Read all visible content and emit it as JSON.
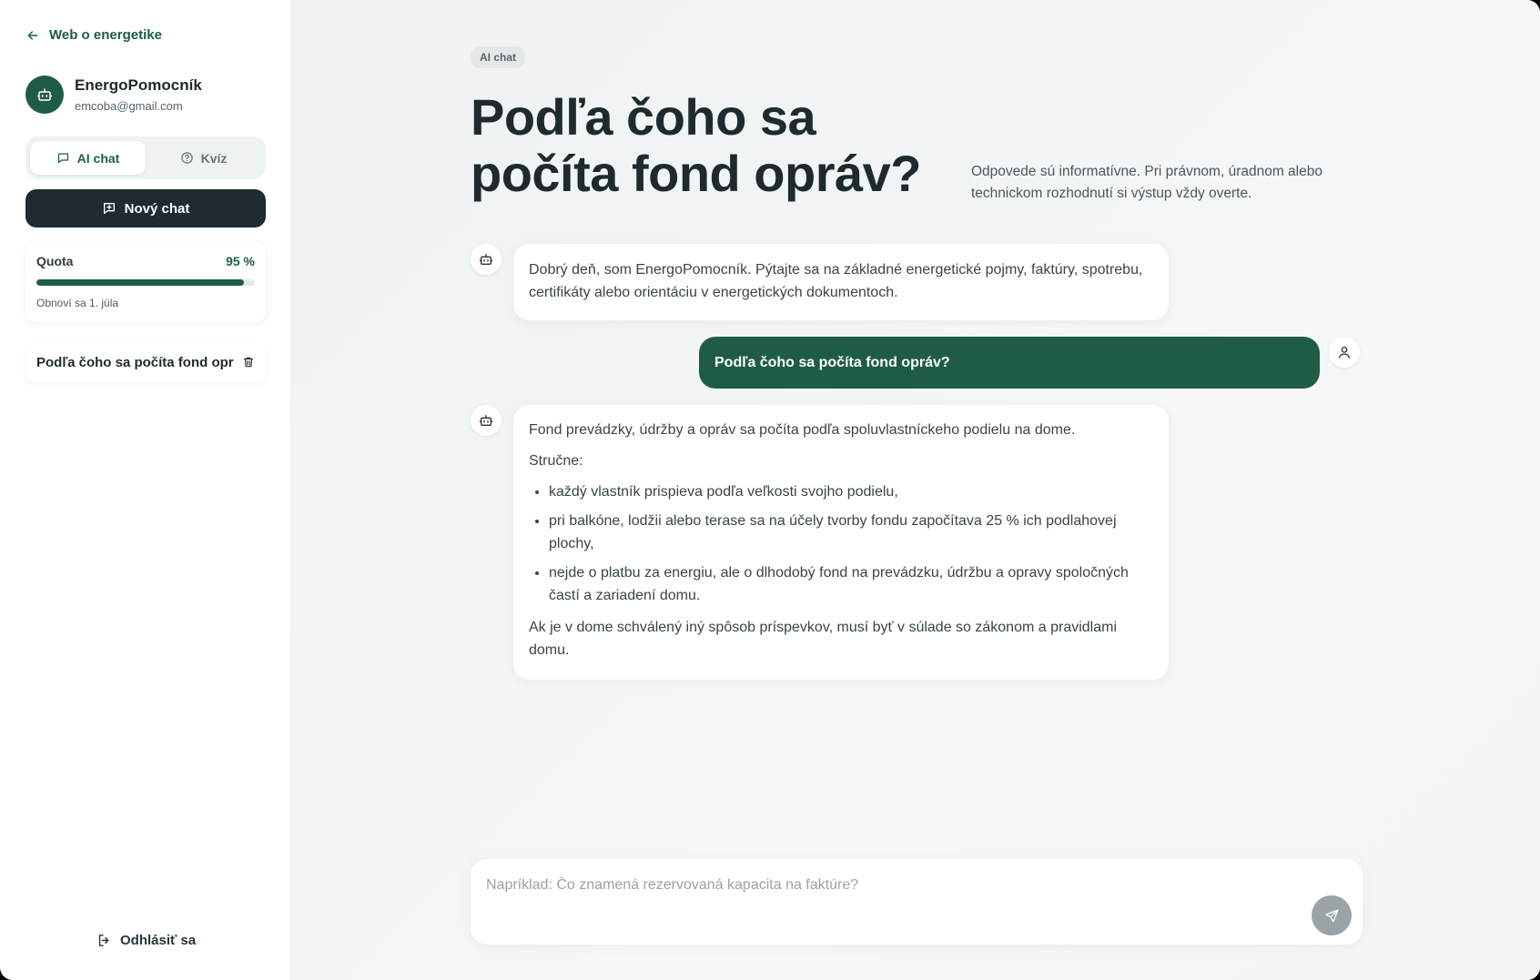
{
  "sidebar": {
    "back_label": "Web o energetike",
    "profile": {
      "name": "EnergoPomocník",
      "email": "emcoba@gmail.com"
    },
    "tabs": [
      {
        "label": "AI chat",
        "icon": "chat-bubble-icon",
        "active": true
      },
      {
        "label": "Kvíz",
        "icon": "question-circle-icon",
        "active": false
      }
    ],
    "new_chat_label": "Nový chat",
    "quota": {
      "label": "Quota",
      "value_text": "95 %",
      "fraction": 0.95,
      "reset_text": "Obnoví sa 1. júla"
    },
    "history": [
      {
        "title": "Podľa čoho sa počíta fond opr"
      }
    ],
    "logout_label": "Odhlásiť sa"
  },
  "main": {
    "tag": "AI chat",
    "title": "Podľa čoho sa počíta fond opráv?",
    "disclaimer": "Odpovede sú informatívne. Pri právnom, úradnom alebo technickom rozhodnutí si výstup vždy overte.",
    "messages": {
      "greeting": "Dobrý deň, som EnergoPomocník. Pýtajte sa na základné energetické pojmy, faktúry, spotrebu, certifikáty alebo orientáciu v energetických dokumentoch.",
      "user_question": "Podľa čoho sa počíta fond opráv?",
      "answer": {
        "intro": "Fond prevádzky, údržby a opráv sa počíta podľa spoluvlastníckeho podielu na dome.",
        "lead": "Stručne:",
        "bullets": [
          "každý vlastník prispieva podľa veľkosti svojho podielu,",
          "pri balkóne, lodžii alebo terase sa na účely tvorby fondu započítava 25 % ich podlahovej plochy,",
          "nejde o platbu za energiu, ale o dlhodobý fond na prevádzku, údržbu a opravy spoločných častí a zariadení domu."
        ],
        "outro": "Ak je v dome schválený iný spôsob príspevkov, musí byť v súlade so zákonom a pravidlami domu."
      }
    },
    "composer": {
      "placeholder": "Napríklad: Čo znamená rezervovaná kapacita na faktúre?"
    }
  },
  "colors": {
    "accent": "#1f5c46",
    "dark_button": "#1f2a31"
  }
}
